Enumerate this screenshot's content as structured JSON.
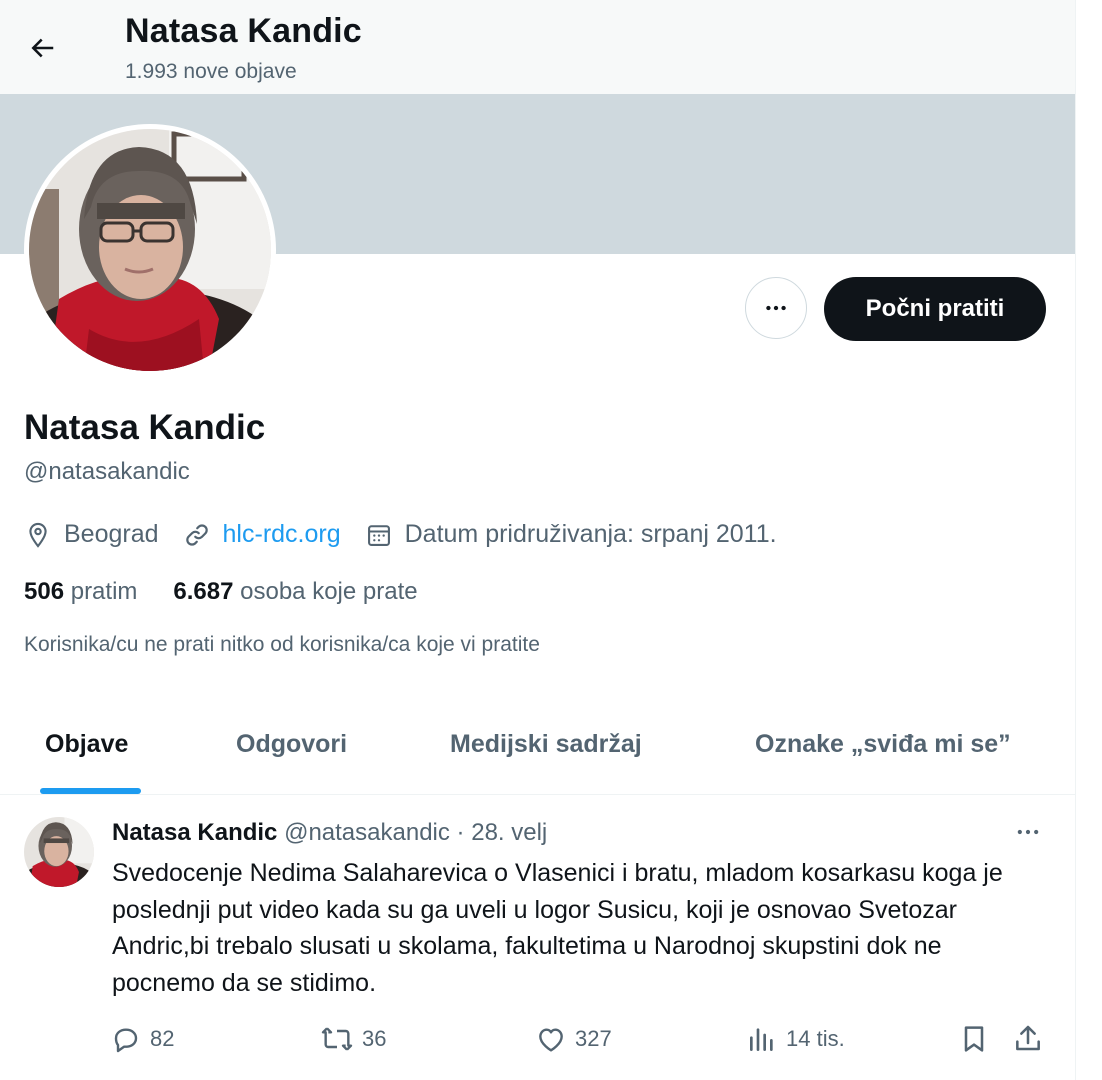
{
  "header": {
    "title": "Natasa Kandic",
    "subtitle": "1.993 nove objave",
    "back_icon": "arrow-left-icon"
  },
  "profile": {
    "name": "Natasa Kandic",
    "handle": "@natasakandic",
    "location": "Beograd",
    "website": "hlc-rdc.org",
    "joined": "Datum pridruživanja: srpanj 2011.",
    "following_count": "506",
    "following_label": "pratim",
    "followers_count": "6.687",
    "followers_label": "osoba koje prate",
    "followed_by_note": "Korisnika/cu ne prati nitko od korisnika/ca koje vi pratite",
    "follow_button": "Počni pratiti",
    "banner_color": "#cfd9de"
  },
  "tabs": [
    {
      "label": "Objave",
      "active": true
    },
    {
      "label": "Odgovori",
      "active": false
    },
    {
      "label": "Medijski sadržaj",
      "active": false
    },
    {
      "label": "Oznake „sviđa mi se”",
      "active": false
    }
  ],
  "tweet": {
    "name": "Natasa Kandic",
    "handle": "@natasakandic",
    "separator": "·",
    "date": "28. velj",
    "text": "Svedocenje Nedima Salaharevica o Vlasenici i bratu, mladom kosarkasu koga je poslednji put video kada su ga uveli u logor Susicu, koji je osnovao Svetozar Andric,bi trebalo slusati u skolama, fakultetima u Narodnoj skupstini dok ne pocnemo da se stidimo.",
    "replies": "82",
    "reposts": "36",
    "likes": "327",
    "views": "14 tis."
  },
  "colors": {
    "accent": "#1d9bf0",
    "text": "#0f1419",
    "muted": "#536471"
  }
}
